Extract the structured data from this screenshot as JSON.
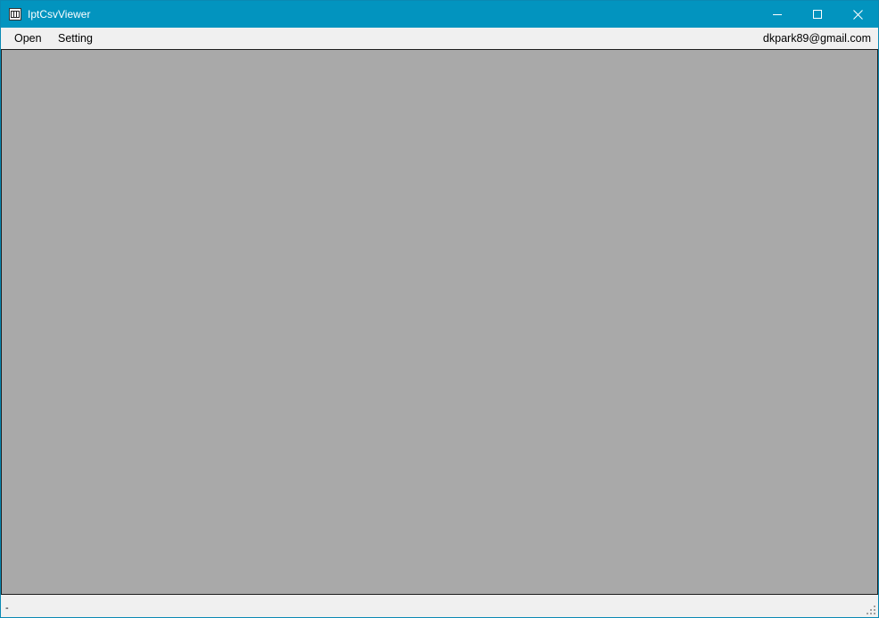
{
  "window": {
    "title": "IptCsvViewer",
    "icon": "csv-app-icon",
    "controls": [
      "minimize-icon",
      "maximize-icon",
      "close-icon"
    ],
    "accent_color": "#0294bf"
  },
  "menubar": {
    "items": [
      {
        "label": "Open"
      },
      {
        "label": "Setting"
      }
    ],
    "email": "dkpark89@gmail.com"
  },
  "content": {
    "background_color": "#a9a9a9"
  },
  "statusbar": {
    "text": "-",
    "grip_icon": "resize-grip-icon"
  }
}
